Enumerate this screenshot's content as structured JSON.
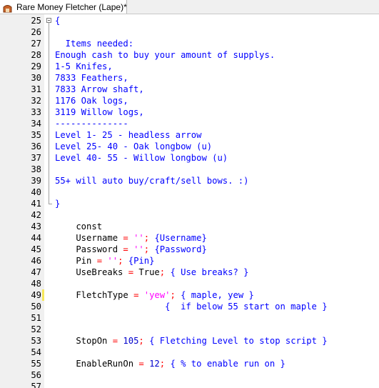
{
  "tab": {
    "title": "Rare Money Fletcher (Lape)*",
    "icon": "script-file-icon"
  },
  "colors": {
    "comment": "#0000ff",
    "symbol": "#ff0000",
    "number": "#0000cc",
    "string": "#ff00ff",
    "gutter_bg": "#f0f0f0",
    "modified_marker": "#f7e85a"
  },
  "lines": [
    {
      "n": "25",
      "tokens": [
        {
          "t": "{",
          "c": "cm"
        }
      ]
    },
    {
      "n": "26",
      "tokens": []
    },
    {
      "n": "27",
      "tokens": [
        {
          "t": "  Items needed:",
          "c": "cm"
        }
      ]
    },
    {
      "n": "28",
      "tokens": [
        {
          "t": "Enough cash to buy your amount of supplys.",
          "c": "cm"
        }
      ]
    },
    {
      "n": "29",
      "tokens": [
        {
          "t": "1-5 Knifes,",
          "c": "cm"
        }
      ]
    },
    {
      "n": "30",
      "tokens": [
        {
          "t": "7833 Feathers,",
          "c": "cm"
        }
      ]
    },
    {
      "n": "31",
      "tokens": [
        {
          "t": "7833 Arrow shaft,",
          "c": "cm"
        }
      ]
    },
    {
      "n": "32",
      "tokens": [
        {
          "t": "1176 Oak logs,",
          "c": "cm"
        }
      ]
    },
    {
      "n": "33",
      "tokens": [
        {
          "t": "3119 Willow logs,",
          "c": "cm"
        }
      ]
    },
    {
      "n": "34",
      "tokens": [
        {
          "t": "--------------",
          "c": "cm"
        }
      ]
    },
    {
      "n": "35",
      "tokens": [
        {
          "t": "Level 1- 25 - headless arrow",
          "c": "cm"
        }
      ]
    },
    {
      "n": "36",
      "tokens": [
        {
          "t": "Level 25- 40 - Oak longbow (u)",
          "c": "cm"
        }
      ]
    },
    {
      "n": "37",
      "tokens": [
        {
          "t": "Level 40- 55 - Willow longbow (u)",
          "c": "cm"
        }
      ]
    },
    {
      "n": "38",
      "tokens": []
    },
    {
      "n": "39",
      "tokens": [
        {
          "t": "55+ will auto buy/craft/sell bows. :)",
          "c": "cm"
        }
      ]
    },
    {
      "n": "40",
      "tokens": []
    },
    {
      "n": "41",
      "tokens": [
        {
          "t": "}",
          "c": "cm"
        }
      ]
    },
    {
      "n": "42",
      "tokens": []
    },
    {
      "n": "43",
      "tokens": [
        {
          "t": "    const",
          "c": "kw"
        }
      ]
    },
    {
      "n": "44",
      "tokens": [
        {
          "t": "    Username ",
          "c": "id"
        },
        {
          "t": "=",
          "c": "sym"
        },
        {
          "t": " ",
          "c": "id"
        },
        {
          "t": "''",
          "c": "str"
        },
        {
          "t": ";",
          "c": "sym"
        },
        {
          "t": " {Username}",
          "c": "cm"
        }
      ]
    },
    {
      "n": "45",
      "tokens": [
        {
          "t": "    Password ",
          "c": "id"
        },
        {
          "t": "=",
          "c": "sym"
        },
        {
          "t": " ",
          "c": "id"
        },
        {
          "t": "''",
          "c": "str"
        },
        {
          "t": ";",
          "c": "sym"
        },
        {
          "t": " {Password}",
          "c": "cm"
        }
      ]
    },
    {
      "n": "46",
      "tokens": [
        {
          "t": "    Pin ",
          "c": "id"
        },
        {
          "t": "=",
          "c": "sym"
        },
        {
          "t": " ",
          "c": "id"
        },
        {
          "t": "''",
          "c": "str"
        },
        {
          "t": ";",
          "c": "sym"
        },
        {
          "t": " {Pin}",
          "c": "cm"
        }
      ]
    },
    {
      "n": "47",
      "tokens": [
        {
          "t": "    UseBreaks ",
          "c": "id"
        },
        {
          "t": "=",
          "c": "sym"
        },
        {
          "t": " True",
          "c": "id"
        },
        {
          "t": ";",
          "c": "sym"
        },
        {
          "t": " { Use breaks? }",
          "c": "cm"
        }
      ]
    },
    {
      "n": "48",
      "tokens": []
    },
    {
      "n": "49",
      "modified": true,
      "tokens": [
        {
          "t": "    FletchType ",
          "c": "id"
        },
        {
          "t": "=",
          "c": "sym"
        },
        {
          "t": " ",
          "c": "id"
        },
        {
          "t": "'yew'",
          "c": "str"
        },
        {
          "t": ";",
          "c": "sym"
        },
        {
          "t": " { maple, yew }",
          "c": "cm"
        }
      ]
    },
    {
      "n": "50",
      "tokens": [
        {
          "t": "                     {  if below 55 start on maple }",
          "c": "cm"
        }
      ]
    },
    {
      "n": "51",
      "tokens": []
    },
    {
      "n": "52",
      "tokens": []
    },
    {
      "n": "53",
      "tokens": [
        {
          "t": "    StopOn ",
          "c": "id"
        },
        {
          "t": "=",
          "c": "sym"
        },
        {
          "t": " ",
          "c": "id"
        },
        {
          "t": "105",
          "c": "num"
        },
        {
          "t": ";",
          "c": "sym"
        },
        {
          "t": " { Fletching Level to stop script }",
          "c": "cm"
        }
      ]
    },
    {
      "n": "54",
      "tokens": []
    },
    {
      "n": "55",
      "tokens": [
        {
          "t": "    EnableRunOn ",
          "c": "id"
        },
        {
          "t": "=",
          "c": "sym"
        },
        {
          "t": " ",
          "c": "id"
        },
        {
          "t": "12",
          "c": "num"
        },
        {
          "t": ";",
          "c": "sym"
        },
        {
          "t": " { % to enable run on }",
          "c": "cm"
        }
      ]
    },
    {
      "n": "56",
      "tokens": []
    },
    {
      "n": "57",
      "tokens": []
    }
  ]
}
